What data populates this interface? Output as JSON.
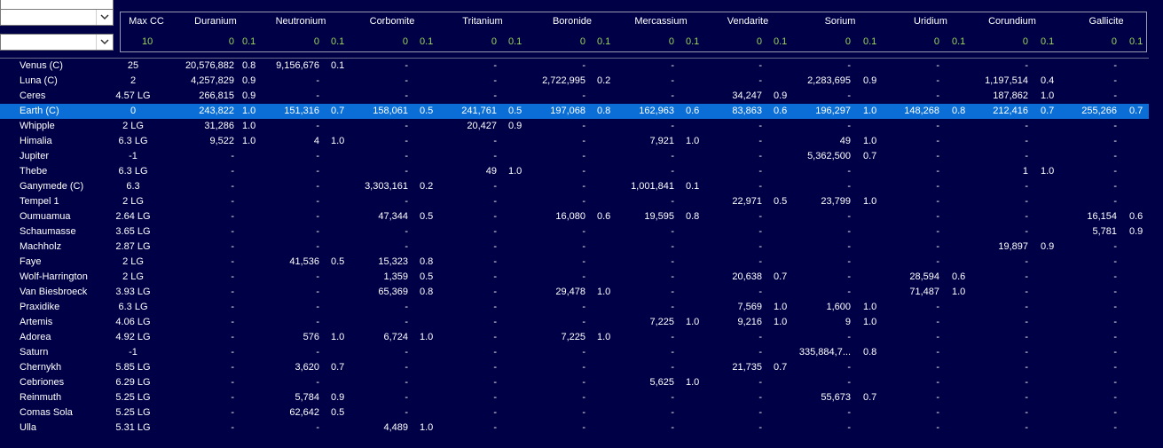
{
  "filters": {
    "combo1_value": "",
    "combo2_value": ""
  },
  "columns": [
    "Max CC",
    "Duranium",
    "Neutronium",
    "Corbomite",
    "Tritanium",
    "Boronide",
    "Mercassium",
    "Vendarite",
    "Sorium",
    "Uridium",
    "Corundium",
    "Gallicite"
  ],
  "header_values": {
    "max_cc": "10",
    "amount": "0",
    "access": "0.1"
  },
  "selected_row": 3,
  "rows": [
    {
      "name": "Venus (C)",
      "cc": "25",
      "m": [
        [
          "20,576,882",
          "0.8"
        ],
        [
          "9,156,676",
          "0.1"
        ],
        [
          "-",
          ""
        ],
        [
          "-",
          ""
        ],
        [
          "-",
          ""
        ],
        [
          "-",
          ""
        ],
        [
          "-",
          ""
        ],
        [
          "-",
          ""
        ],
        [
          "-",
          ""
        ],
        [
          "-",
          ""
        ],
        [
          "-",
          ""
        ]
      ]
    },
    {
      "name": "Luna (C)",
      "cc": "2",
      "m": [
        [
          "4,257,829",
          "0.9"
        ],
        [
          "-",
          ""
        ],
        [
          "-",
          ""
        ],
        [
          "-",
          ""
        ],
        [
          "2,722,995",
          "0.2"
        ],
        [
          "-",
          ""
        ],
        [
          "-",
          ""
        ],
        [
          "2,283,695",
          "0.9"
        ],
        [
          "-",
          ""
        ],
        [
          "1,197,514",
          "0.4"
        ],
        [
          "-",
          ""
        ]
      ]
    },
    {
      "name": "Ceres",
      "cc": "4.57 LG",
      "m": [
        [
          "266,815",
          "0.9"
        ],
        [
          "-",
          ""
        ],
        [
          "-",
          ""
        ],
        [
          "-",
          ""
        ],
        [
          "-",
          ""
        ],
        [
          "-",
          ""
        ],
        [
          "34,247",
          "0.9"
        ],
        [
          "-",
          ""
        ],
        [
          "-",
          ""
        ],
        [
          "187,862",
          "1.0"
        ],
        [
          "-",
          ""
        ]
      ]
    },
    {
      "name": "Earth (C)",
      "cc": "0",
      "m": [
        [
          "243,822",
          "1.0"
        ],
        [
          "151,316",
          "0.7"
        ],
        [
          "158,061",
          "0.5"
        ],
        [
          "241,761",
          "0.5"
        ],
        [
          "197,068",
          "0.8"
        ],
        [
          "162,963",
          "0.6"
        ],
        [
          "83,863",
          "0.6"
        ],
        [
          "196,297",
          "1.0"
        ],
        [
          "148,268",
          "0.8"
        ],
        [
          "212,416",
          "0.7"
        ],
        [
          "255,266",
          "0.7"
        ]
      ]
    },
    {
      "name": "Whipple",
      "cc": "2 LG",
      "m": [
        [
          "31,286",
          "1.0"
        ],
        [
          "-",
          ""
        ],
        [
          "-",
          ""
        ],
        [
          "20,427",
          "0.9"
        ],
        [
          "-",
          ""
        ],
        [
          "-",
          ""
        ],
        [
          "-",
          ""
        ],
        [
          "-",
          ""
        ],
        [
          "-",
          ""
        ],
        [
          "-",
          ""
        ],
        [
          "-",
          ""
        ]
      ]
    },
    {
      "name": "Himalia",
      "cc": "6.3 LG",
      "m": [
        [
          "9,522",
          "1.0"
        ],
        [
          "4",
          "1.0"
        ],
        [
          "-",
          ""
        ],
        [
          "-",
          ""
        ],
        [
          "-",
          ""
        ],
        [
          "7,921",
          "1.0"
        ],
        [
          "-",
          ""
        ],
        [
          "49",
          "1.0"
        ],
        [
          "-",
          ""
        ],
        [
          "-",
          ""
        ],
        [
          "-",
          ""
        ]
      ]
    },
    {
      "name": "Jupiter",
      "cc": "-1",
      "m": [
        [
          "-",
          ""
        ],
        [
          "-",
          ""
        ],
        [
          "-",
          ""
        ],
        [
          "-",
          ""
        ],
        [
          "-",
          ""
        ],
        [
          "-",
          ""
        ],
        [
          "-",
          ""
        ],
        [
          "5,362,500",
          "0.7"
        ],
        [
          "-",
          ""
        ],
        [
          "-",
          ""
        ],
        [
          "-",
          ""
        ]
      ]
    },
    {
      "name": "Thebe",
      "cc": "6.3 LG",
      "m": [
        [
          "-",
          ""
        ],
        [
          "-",
          ""
        ],
        [
          "-",
          ""
        ],
        [
          "49",
          "1.0"
        ],
        [
          "-",
          ""
        ],
        [
          "-",
          ""
        ],
        [
          "-",
          ""
        ],
        [
          "-",
          ""
        ],
        [
          "-",
          ""
        ],
        [
          "1",
          "1.0"
        ],
        [
          "-",
          ""
        ]
      ]
    },
    {
      "name": "Ganymede (C)",
      "cc": "6.3",
      "m": [
        [
          "-",
          ""
        ],
        [
          "-",
          ""
        ],
        [
          "3,303,161",
          "0.2"
        ],
        [
          "-",
          ""
        ],
        [
          "-",
          ""
        ],
        [
          "1,001,841",
          "0.1"
        ],
        [
          "-",
          ""
        ],
        [
          "-",
          ""
        ],
        [
          "-",
          ""
        ],
        [
          "-",
          ""
        ],
        [
          "-",
          ""
        ]
      ]
    },
    {
      "name": "Tempel 1",
      "cc": "2 LG",
      "m": [
        [
          "-",
          ""
        ],
        [
          "-",
          ""
        ],
        [
          "-",
          ""
        ],
        [
          "-",
          ""
        ],
        [
          "-",
          ""
        ],
        [
          "-",
          ""
        ],
        [
          "22,971",
          "0.5"
        ],
        [
          "23,799",
          "1.0"
        ],
        [
          "-",
          ""
        ],
        [
          "-",
          ""
        ],
        [
          "-",
          ""
        ]
      ]
    },
    {
      "name": "Oumuamua",
      "cc": "2.64 LG",
      "m": [
        [
          "-",
          ""
        ],
        [
          "-",
          ""
        ],
        [
          "47,344",
          "0.5"
        ],
        [
          "-",
          ""
        ],
        [
          "16,080",
          "0.6"
        ],
        [
          "19,595",
          "0.8"
        ],
        [
          "-",
          ""
        ],
        [
          "-",
          ""
        ],
        [
          "-",
          ""
        ],
        [
          "-",
          ""
        ],
        [
          "16,154",
          "0.6"
        ]
      ]
    },
    {
      "name": "Schaumasse",
      "cc": "3.65 LG",
      "m": [
        [
          "-",
          ""
        ],
        [
          "-",
          ""
        ],
        [
          "-",
          ""
        ],
        [
          "-",
          ""
        ],
        [
          "-",
          ""
        ],
        [
          "-",
          ""
        ],
        [
          "-",
          ""
        ],
        [
          "-",
          ""
        ],
        [
          "-",
          ""
        ],
        [
          "-",
          ""
        ],
        [
          "5,781",
          "0.9"
        ]
      ]
    },
    {
      "name": "Machholz",
      "cc": "2.87 LG",
      "m": [
        [
          "-",
          ""
        ],
        [
          "-",
          ""
        ],
        [
          "-",
          ""
        ],
        [
          "-",
          ""
        ],
        [
          "-",
          ""
        ],
        [
          "-",
          ""
        ],
        [
          "-",
          ""
        ],
        [
          "-",
          ""
        ],
        [
          "-",
          ""
        ],
        [
          "19,897",
          "0.9"
        ],
        [
          "-",
          ""
        ]
      ]
    },
    {
      "name": "Faye",
      "cc": "2 LG",
      "m": [
        [
          "-",
          ""
        ],
        [
          "41,536",
          "0.5"
        ],
        [
          "15,323",
          "0.8"
        ],
        [
          "-",
          ""
        ],
        [
          "-",
          ""
        ],
        [
          "-",
          ""
        ],
        [
          "-",
          ""
        ],
        [
          "-",
          ""
        ],
        [
          "-",
          ""
        ],
        [
          "-",
          ""
        ],
        [
          "-",
          ""
        ]
      ]
    },
    {
      "name": "Wolf-Harrington",
      "cc": "2 LG",
      "m": [
        [
          "-",
          ""
        ],
        [
          "-",
          ""
        ],
        [
          "1,359",
          "0.5"
        ],
        [
          "-",
          ""
        ],
        [
          "-",
          ""
        ],
        [
          "-",
          ""
        ],
        [
          "20,638",
          "0.7"
        ],
        [
          "-",
          ""
        ],
        [
          "28,594",
          "0.6"
        ],
        [
          "-",
          ""
        ],
        [
          "-",
          ""
        ]
      ]
    },
    {
      "name": "Van Biesbroeck",
      "cc": "3.93 LG",
      "m": [
        [
          "-",
          ""
        ],
        [
          "-",
          ""
        ],
        [
          "65,369",
          "0.8"
        ],
        [
          "-",
          ""
        ],
        [
          "29,478",
          "1.0"
        ],
        [
          "-",
          ""
        ],
        [
          "-",
          ""
        ],
        [
          "-",
          ""
        ],
        [
          "71,487",
          "1.0"
        ],
        [
          "-",
          ""
        ],
        [
          "-",
          ""
        ]
      ]
    },
    {
      "name": "Praxidike",
      "cc": "6.3 LG",
      "m": [
        [
          "-",
          ""
        ],
        [
          "-",
          ""
        ],
        [
          "-",
          ""
        ],
        [
          "-",
          ""
        ],
        [
          "-",
          ""
        ],
        [
          "-",
          ""
        ],
        [
          "7,569",
          "1.0"
        ],
        [
          "1,600",
          "1.0"
        ],
        [
          "-",
          ""
        ],
        [
          "-",
          ""
        ],
        [
          "-",
          ""
        ]
      ]
    },
    {
      "name": "Artemis",
      "cc": "4.06 LG",
      "m": [
        [
          "-",
          ""
        ],
        [
          "-",
          ""
        ],
        [
          "-",
          ""
        ],
        [
          "-",
          ""
        ],
        [
          "-",
          ""
        ],
        [
          "7,225",
          "1.0"
        ],
        [
          "9,216",
          "1.0"
        ],
        [
          "9",
          "1.0"
        ],
        [
          "-",
          ""
        ],
        [
          "-",
          ""
        ],
        [
          "-",
          ""
        ]
      ]
    },
    {
      "name": "Adorea",
      "cc": "4.92 LG",
      "m": [
        [
          "-",
          ""
        ],
        [
          "576",
          "1.0"
        ],
        [
          "6,724",
          "1.0"
        ],
        [
          "-",
          ""
        ],
        [
          "7,225",
          "1.0"
        ],
        [
          "-",
          ""
        ],
        [
          "-",
          ""
        ],
        [
          "-",
          ""
        ],
        [
          "-",
          ""
        ],
        [
          "-",
          ""
        ],
        [
          "-",
          ""
        ]
      ]
    },
    {
      "name": "Saturn",
      "cc": "-1",
      "m": [
        [
          "-",
          ""
        ],
        [
          "-",
          ""
        ],
        [
          "-",
          ""
        ],
        [
          "-",
          ""
        ],
        [
          "-",
          ""
        ],
        [
          "-",
          ""
        ],
        [
          "-",
          ""
        ],
        [
          "335,884,7...",
          "0.8"
        ],
        [
          "-",
          ""
        ],
        [
          "-",
          ""
        ],
        [
          "-",
          ""
        ]
      ]
    },
    {
      "name": "Chernykh",
      "cc": "5.85 LG",
      "m": [
        [
          "-",
          ""
        ],
        [
          "3,620",
          "0.7"
        ],
        [
          "-",
          ""
        ],
        [
          "-",
          ""
        ],
        [
          "-",
          ""
        ],
        [
          "-",
          ""
        ],
        [
          "21,735",
          "0.7"
        ],
        [
          "-",
          ""
        ],
        [
          "-",
          ""
        ],
        [
          "-",
          ""
        ],
        [
          "-",
          ""
        ]
      ]
    },
    {
      "name": "Cebriones",
      "cc": "6.29 LG",
      "m": [
        [
          "-",
          ""
        ],
        [
          "-",
          ""
        ],
        [
          "-",
          ""
        ],
        [
          "-",
          ""
        ],
        [
          "-",
          ""
        ],
        [
          "5,625",
          "1.0"
        ],
        [
          "-",
          ""
        ],
        [
          "-",
          ""
        ],
        [
          "-",
          ""
        ],
        [
          "-",
          ""
        ],
        [
          "-",
          ""
        ]
      ]
    },
    {
      "name": "Reinmuth",
      "cc": "5.25 LG",
      "m": [
        [
          "-",
          ""
        ],
        [
          "5,784",
          "0.9"
        ],
        [
          "-",
          ""
        ],
        [
          "-",
          ""
        ],
        [
          "-",
          ""
        ],
        [
          "-",
          ""
        ],
        [
          "-",
          ""
        ],
        [
          "55,673",
          "0.7"
        ],
        [
          "-",
          ""
        ],
        [
          "-",
          ""
        ],
        [
          "-",
          ""
        ]
      ]
    },
    {
      "name": "Comas Sola",
      "cc": "5.25 LG",
      "m": [
        [
          "-",
          ""
        ],
        [
          "62,642",
          "0.5"
        ],
        [
          "-",
          ""
        ],
        [
          "-",
          ""
        ],
        [
          "-",
          ""
        ],
        [
          "-",
          ""
        ],
        [
          "-",
          ""
        ],
        [
          "-",
          ""
        ],
        [
          "-",
          ""
        ],
        [
          "-",
          ""
        ],
        [
          "-",
          ""
        ]
      ]
    },
    {
      "name": "Ulla",
      "cc": "5.31 LG",
      "m": [
        [
          "-",
          ""
        ],
        [
          "-",
          ""
        ],
        [
          "4,489",
          "1.0"
        ],
        [
          "-",
          ""
        ],
        [
          "-",
          ""
        ],
        [
          "-",
          ""
        ],
        [
          "-",
          ""
        ],
        [
          "-",
          ""
        ],
        [
          "-",
          ""
        ],
        [
          "-",
          ""
        ],
        [
          "-",
          ""
        ]
      ]
    }
  ]
}
